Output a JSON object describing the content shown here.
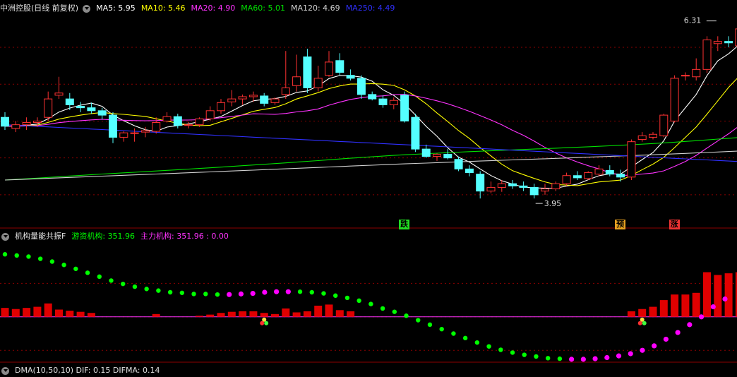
{
  "header": {
    "stock": "中洲控股(日线 前复权)",
    "items": [
      {
        "label": "MA5: 5.95",
        "color": "#ffffff"
      },
      {
        "label": "MA10: 5.46",
        "color": "#ffff00"
      },
      {
        "label": "MA20: 4.90",
        "color": "#ff33ff"
      },
      {
        "label": "MA60: 5.01",
        "color": "#00e000"
      },
      {
        "label": "MA120: 4.69",
        "color": "#d0d0d0"
      },
      {
        "label": "MA250: 4.49",
        "color": "#3030ff"
      }
    ]
  },
  "lower_header": {
    "title": "机构量能共振F",
    "items": [
      {
        "label": "游资机构: 351.96",
        "color": "#00ff00"
      },
      {
        "label": "主力机构: 351.96 : 0.00",
        "color": "#ff33ff"
      }
    ]
  },
  "bottom_header": {
    "text": "DMA(10,50,10) DIF: 0.15 DIFMA: 0.14"
  },
  "signals": [
    {
      "label": "跌",
      "index": 37,
      "bg": "#22dd22"
    },
    {
      "label": "预",
      "index": 57,
      "bg": "#e6a020"
    },
    {
      "label": "涨",
      "index": 62,
      "bg": "#ee3333"
    }
  ],
  "annotations": {
    "high": {
      "label": "6.31",
      "index": 66,
      "value": 6.31
    },
    "low": {
      "label": "3.95",
      "index": 49,
      "value": 3.95
    }
  },
  "colors": {
    "up": "#ff3232",
    "down": "#54ffff",
    "grid": "#8b0000",
    "dot_green": "#00ff00",
    "dot_magenta": "#ff00ff",
    "volume": "#e00000",
    "zero_line": "#ff33ff"
  },
  "chart_data": [
    {
      "type": "candlestick",
      "title": "中洲控股(日线 前复权)",
      "ylim": [
        3.75,
        6.45
      ],
      "ohlc": [
        [
          5.05,
          5.12,
          4.88,
          4.93
        ],
        [
          4.9,
          5.0,
          4.85,
          4.95
        ],
        [
          4.95,
          5.05,
          4.88,
          4.98
        ],
        [
          4.98,
          5.05,
          4.92,
          5.0
        ],
        [
          5.05,
          5.4,
          5.0,
          5.3
        ],
        [
          5.35,
          5.6,
          5.3,
          5.38
        ],
        [
          5.3,
          5.38,
          5.15,
          5.22
        ],
        [
          5.2,
          5.26,
          5.12,
          5.18
        ],
        [
          5.18,
          5.25,
          5.1,
          5.14
        ],
        [
          5.14,
          5.18,
          5.02,
          5.08
        ],
        [
          5.08,
          5.12,
          4.7,
          4.78
        ],
        [
          4.78,
          4.86,
          4.72,
          4.84
        ],
        [
          4.84,
          4.9,
          4.72,
          4.84
        ],
        [
          4.85,
          4.92,
          4.78,
          4.87
        ],
        [
          4.86,
          5.05,
          4.83,
          4.98
        ],
        [
          5.0,
          5.12,
          4.98,
          5.06
        ],
        [
          5.06,
          5.1,
          4.9,
          4.94
        ],
        [
          4.94,
          4.99,
          4.9,
          4.95
        ],
        [
          4.95,
          5.05,
          4.92,
          5.03
        ],
        [
          5.03,
          5.2,
          5.0,
          5.14
        ],
        [
          5.14,
          5.3,
          5.1,
          5.25
        ],
        [
          5.26,
          5.42,
          5.2,
          5.3
        ],
        [
          5.3,
          5.36,
          5.22,
          5.33
        ],
        [
          5.33,
          5.4,
          5.26,
          5.35
        ],
        [
          5.34,
          5.38,
          5.2,
          5.24
        ],
        [
          5.25,
          5.32,
          5.22,
          5.3
        ],
        [
          5.36,
          5.95,
          5.3,
          5.45
        ],
        [
          5.48,
          5.9,
          5.4,
          5.6
        ],
        [
          5.87,
          5.98,
          5.38,
          5.45
        ],
        [
          5.45,
          5.75,
          5.4,
          5.58
        ],
        [
          5.62,
          5.95,
          5.6,
          5.8
        ],
        [
          5.82,
          5.92,
          5.62,
          5.66
        ],
        [
          5.62,
          5.7,
          5.55,
          5.58
        ],
        [
          5.58,
          5.62,
          5.3,
          5.36
        ],
        [
          5.36,
          5.4,
          5.28,
          5.3
        ],
        [
          5.3,
          5.35,
          5.18,
          5.22
        ],
        [
          5.22,
          5.32,
          5.16,
          5.28
        ],
        [
          5.35,
          5.4,
          4.98,
          5.0
        ],
        [
          5.05,
          5.1,
          4.58,
          4.62
        ],
        [
          4.62,
          4.68,
          4.5,
          4.52
        ],
        [
          4.52,
          4.56,
          4.46,
          4.55
        ],
        [
          4.55,
          4.62,
          4.48,
          4.5
        ],
        [
          4.48,
          4.52,
          4.32,
          4.35
        ],
        [
          4.35,
          4.4,
          4.25,
          4.3
        ],
        [
          4.28,
          4.32,
          3.95,
          4.05
        ],
        [
          4.05,
          4.18,
          4.02,
          4.1
        ],
        [
          4.1,
          4.2,
          4.04,
          4.15
        ],
        [
          4.15,
          4.2,
          4.08,
          4.12
        ],
        [
          4.12,
          4.18,
          4.05,
          4.1
        ],
        [
          4.1,
          4.15,
          3.95,
          4.0
        ],
        [
          4.05,
          4.15,
          4.0,
          4.08
        ],
        [
          4.08,
          4.18,
          4.05,
          4.15
        ],
        [
          4.15,
          4.3,
          4.12,
          4.26
        ],
        [
          4.26,
          4.32,
          4.2,
          4.23
        ],
        [
          4.22,
          4.32,
          4.2,
          4.3
        ],
        [
          4.28,
          4.4,
          4.25,
          4.35
        ],
        [
          4.33,
          4.4,
          4.25,
          4.28
        ],
        [
          4.28,
          4.34,
          4.18,
          4.24
        ],
        [
          4.24,
          4.75,
          4.2,
          4.72
        ],
        [
          4.75,
          4.85,
          4.72,
          4.8
        ],
        [
          4.78,
          4.85,
          4.75,
          4.82
        ],
        [
          4.8,
          5.1,
          4.78,
          5.08
        ],
        [
          5.0,
          5.62,
          4.98,
          5.58
        ],
        [
          5.62,
          5.66,
          5.55,
          5.62
        ],
        [
          5.6,
          5.85,
          5.55,
          5.7
        ],
        [
          5.7,
          6.15,
          5.65,
          6.1
        ],
        [
          6.05,
          6.15,
          5.95,
          6.08
        ],
        [
          6.08,
          6.15,
          6.0,
          6.06
        ],
        [
          6.02,
          6.31,
          5.98,
          6.25
        ]
      ],
      "ma": [
        {
          "name": "MA5",
          "period": 5,
          "color": "#ffffff"
        },
        {
          "name": "MA10",
          "period": 10,
          "color": "#ffff00"
        },
        {
          "name": "MA20",
          "period": 20,
          "color": "#ff33ff"
        },
        {
          "name": "MA60",
          "period": 60,
          "color": "#00e000"
        },
        {
          "name": "MA120",
          "period": 120,
          "color": "#d0d0d0"
        },
        {
          "name": "MA250",
          "period": 250,
          "color": "#3030ff"
        }
      ]
    },
    {
      "type": "bar+scatter",
      "title": "机构量能共振F",
      "ylim": [
        -85,
        130
      ],
      "volume_bars": [
        16,
        14,
        16,
        18,
        24,
        13,
        11,
        9,
        7,
        0,
        0,
        0,
        0,
        0,
        5,
        0,
        0,
        0,
        2,
        4,
        7,
        9,
        10,
        10,
        7,
        5,
        15,
        8,
        10,
        20,
        22,
        12,
        10,
        0,
        0,
        0,
        0,
        0,
        0,
        0,
        0,
        0,
        0,
        0,
        0,
        0,
        0,
        0,
        0,
        0,
        0,
        0,
        0,
        0,
        0,
        0,
        0,
        0,
        10,
        14,
        18,
        30,
        40,
        40,
        43,
        80,
        75,
        78,
        80
      ],
      "dots": [
        {
          "x": 0.0,
          "y": 112,
          "c": "g"
        },
        {
          "x": 1.5,
          "y": 110,
          "c": "g"
        },
        {
          "x": 3.0,
          "y": 108,
          "c": "g"
        },
        {
          "x": 4.5,
          "y": 104,
          "c": "g"
        },
        {
          "x": 6.0,
          "y": 99,
          "c": "g"
        },
        {
          "x": 7.5,
          "y": 93,
          "c": "g"
        },
        {
          "x": 9.0,
          "y": 86,
          "c": "g"
        },
        {
          "x": 10.5,
          "y": 79,
          "c": "g"
        },
        {
          "x": 12.0,
          "y": 72,
          "c": "g"
        },
        {
          "x": 13.5,
          "y": 65,
          "c": "g"
        },
        {
          "x": 15.0,
          "y": 59,
          "c": "g"
        },
        {
          "x": 16.5,
          "y": 54,
          "c": "g"
        },
        {
          "x": 18.0,
          "y": 50,
          "c": "g"
        },
        {
          "x": 19.5,
          "y": 47,
          "c": "g"
        },
        {
          "x": 21.0,
          "y": 44,
          "c": "g"
        },
        {
          "x": 22.5,
          "y": 43,
          "c": "g"
        },
        {
          "x": 24.0,
          "y": 41,
          "c": "g"
        },
        {
          "x": 25.5,
          "y": 41,
          "c": "g"
        },
        {
          "x": 27.0,
          "y": 40,
          "c": "g"
        },
        {
          "x": 28.5,
          "y": 40,
          "c": "m"
        },
        {
          "x": 30.0,
          "y": 41,
          "c": "m"
        },
        {
          "x": 31.5,
          "y": 42,
          "c": "m"
        },
        {
          "x": 33.0,
          "y": 44,
          "c": "m"
        },
        {
          "x": 34.5,
          "y": 45,
          "c": "m"
        },
        {
          "x": 36.0,
          "y": 45,
          "c": "m"
        },
        {
          "x": 37.5,
          "y": 45,
          "c": "g"
        },
        {
          "x": 39.0,
          "y": 44,
          "c": "g"
        },
        {
          "x": 40.5,
          "y": 42,
          "c": "g"
        },
        {
          "x": 42.0,
          "y": 38,
          "c": "g"
        },
        {
          "x": 43.5,
          "y": 34,
          "c": "g"
        },
        {
          "x": 45.0,
          "y": 29,
          "c": "g"
        },
        {
          "x": 46.5,
          "y": 23,
          "c": "g"
        },
        {
          "x": 48.0,
          "y": 15,
          "c": "g"
        },
        {
          "x": 49.5,
          "y": 9,
          "c": "g"
        },
        {
          "x": 51.0,
          "y": 2,
          "c": "g"
        },
        {
          "x": 52.5,
          "y": -6,
          "c": "g"
        },
        {
          "x": 54.0,
          "y": -14,
          "c": "g"
        },
        {
          "x": 55.5,
          "y": -22,
          "c": "g"
        },
        {
          "x": 57.0,
          "y": -30,
          "c": "g"
        },
        {
          "x": 58.5,
          "y": -38,
          "c": "g"
        },
        {
          "x": 60.0,
          "y": -46,
          "c": "g"
        },
        {
          "x": 61.5,
          "y": -53,
          "c": "g"
        },
        {
          "x": 63.0,
          "y": -59,
          "c": "g"
        },
        {
          "x": 64.5,
          "y": -64,
          "c": "g"
        },
        {
          "x": 66.0,
          "y": -68,
          "c": "g"
        },
        {
          "x": 67.5,
          "y": -71,
          "c": "g"
        },
        {
          "x": 69.0,
          "y": -74,
          "c": "g"
        },
        {
          "x": 70.5,
          "y": -75,
          "c": "g"
        },
        {
          "x": 72.0,
          "y": -76,
          "c": "m"
        },
        {
          "x": 73.5,
          "y": -76,
          "c": "m"
        },
        {
          "x": 75.0,
          "y": -75,
          "c": "m"
        },
        {
          "x": 76.5,
          "y": -73,
          "c": "m"
        },
        {
          "x": 78.0,
          "y": -70,
          "c": "m"
        },
        {
          "x": 79.5,
          "y": -66,
          "c": "m"
        },
        {
          "x": 81.0,
          "y": -60,
          "c": "m"
        },
        {
          "x": 82.5,
          "y": -52,
          "c": "m"
        },
        {
          "x": 84.0,
          "y": -40,
          "c": "m"
        },
        {
          "x": 85.5,
          "y": -28,
          "c": "m"
        },
        {
          "x": 87.0,
          "y": -14,
          "c": "m"
        },
        {
          "x": 88.5,
          "y": 0,
          "c": "m"
        },
        {
          "x": 90.0,
          "y": 18,
          "c": "m"
        },
        {
          "x": 91.5,
          "y": 32,
          "c": "m"
        }
      ],
      "markers": [
        24,
        59
      ]
    }
  ]
}
